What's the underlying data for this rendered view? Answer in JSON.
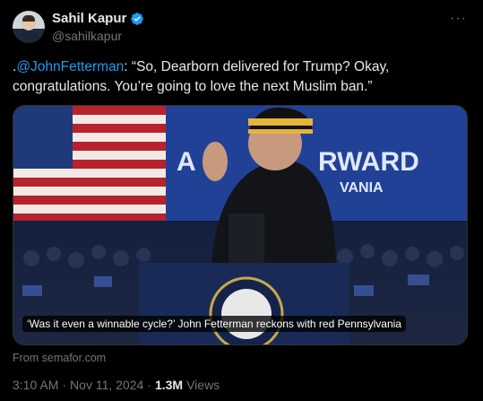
{
  "author": {
    "name": "Sahil Kapur",
    "handle": "@sahilkapur"
  },
  "tweet": {
    "prefix": ".",
    "mention": "@JohnFetterman",
    "body": ": “So, Dearborn delivered for Trump? Okay, congratulations. You’re going to love the next Muslim ban.”"
  },
  "card": {
    "caption": "‘Was it even a winnable cycle?’ John Fetterman reckons with red Pennsylvania",
    "banner_text_left": "A N",
    "banner_text_right": "RWARD",
    "banner_text_sub": "VANIA",
    "source": "From semafor.com"
  },
  "meta": {
    "time": "3:10 AM",
    "separator": "·",
    "date": "Nov 11, 2024",
    "separator2": "·",
    "views_count": "1.3M",
    "views_label": "Views"
  },
  "colors": {
    "accent": "#1d9bf0",
    "muted": "#71767b",
    "text": "#e7e9ea",
    "background": "#000000"
  },
  "icons": [
    "verified-badge-icon",
    "more-options-icon"
  ]
}
